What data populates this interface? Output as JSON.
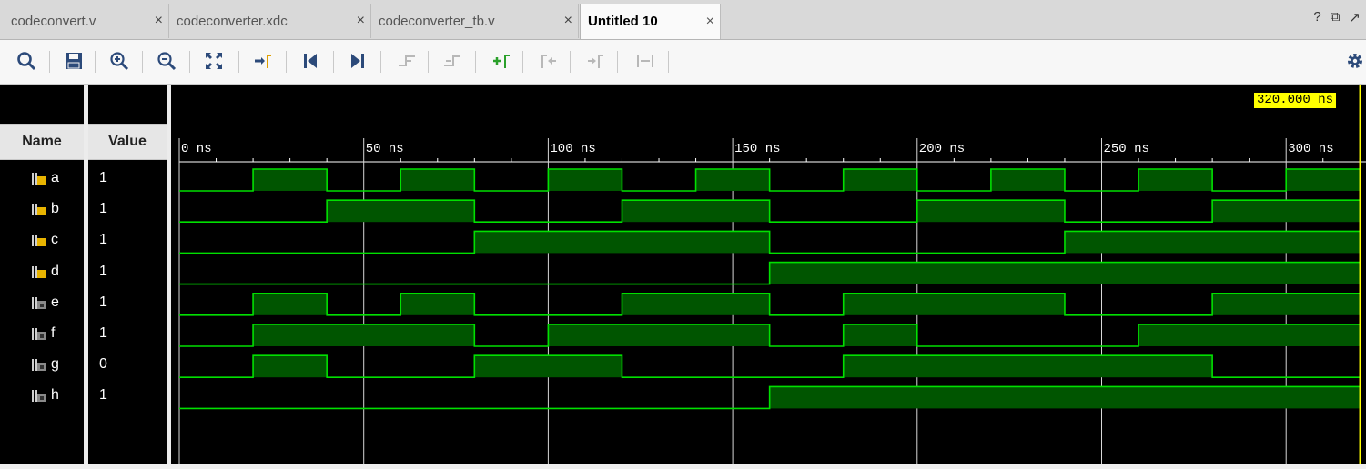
{
  "tabs": [
    {
      "label": "codeconvert.v",
      "active": false
    },
    {
      "label": "codeconverter.xdc",
      "active": false
    },
    {
      "label": "codeconverter_tb.v",
      "active": false
    },
    {
      "label": "Untitled 10",
      "active": true
    }
  ],
  "tab_close_glyph": "×",
  "window_controls": {
    "help": "?",
    "restore": "⧉",
    "float": "↗"
  },
  "toolbar_icons": [
    "search-icon",
    "save-icon",
    "zoom-in-icon",
    "zoom-out-icon",
    "zoom-fit-icon",
    "go-to-cursor-icon",
    "go-to-start-icon",
    "go-to-end-icon",
    "previous-transition-icon",
    "next-transition-icon",
    "add-marker-icon",
    "previous-marker-icon",
    "next-marker-icon",
    "swap-cursors-icon"
  ],
  "settings_icon": "gear-icon",
  "columns": {
    "name": "Name",
    "value": "Value"
  },
  "cursor_time_label": "320.000 ns",
  "timeline": {
    "unit": "ns",
    "start": 0,
    "end": 320,
    "major_ticks": [
      0,
      50,
      100,
      150,
      200,
      250,
      300
    ],
    "tick_labels": [
      "0 ns",
      "50 ns",
      "100 ns",
      "150 ns",
      "200 ns",
      "250 ns",
      "300 ns"
    ]
  },
  "colors": {
    "wave": "#00e000",
    "high_fill": "#005500",
    "cursor": "#ffff00",
    "background": "#000000"
  },
  "signals": [
    {
      "name": "a",
      "value": "1",
      "type": "input",
      "transitions": [
        [
          0,
          0
        ],
        [
          20,
          1
        ],
        [
          40,
          0
        ],
        [
          60,
          1
        ],
        [
          80,
          0
        ],
        [
          100,
          1
        ],
        [
          120,
          0
        ],
        [
          140,
          1
        ],
        [
          160,
          0
        ],
        [
          180,
          1
        ],
        [
          200,
          0
        ],
        [
          220,
          1
        ],
        [
          240,
          0
        ],
        [
          260,
          1
        ],
        [
          280,
          0
        ],
        [
          300,
          1
        ]
      ]
    },
    {
      "name": "b",
      "value": "1",
      "type": "input",
      "transitions": [
        [
          0,
          0
        ],
        [
          40,
          1
        ],
        [
          80,
          0
        ],
        [
          120,
          1
        ],
        [
          160,
          0
        ],
        [
          200,
          1
        ],
        [
          240,
          0
        ],
        [
          280,
          1
        ]
      ]
    },
    {
      "name": "c",
      "value": "1",
      "type": "input",
      "transitions": [
        [
          0,
          0
        ],
        [
          80,
          1
        ],
        [
          160,
          0
        ],
        [
          240,
          1
        ]
      ]
    },
    {
      "name": "d",
      "value": "1",
      "type": "input",
      "transitions": [
        [
          0,
          0
        ],
        [
          160,
          1
        ]
      ]
    },
    {
      "name": "e",
      "value": "1",
      "type": "output",
      "transitions": [
        [
          0,
          0
        ],
        [
          20,
          1
        ],
        [
          40,
          0
        ],
        [
          60,
          1
        ],
        [
          80,
          0
        ],
        [
          120,
          1
        ],
        [
          160,
          0
        ],
        [
          180,
          1
        ],
        [
          240,
          0
        ],
        [
          280,
          1
        ]
      ]
    },
    {
      "name": "f",
      "value": "1",
      "type": "output",
      "transitions": [
        [
          0,
          0
        ],
        [
          20,
          1
        ],
        [
          80,
          0
        ],
        [
          100,
          1
        ],
        [
          160,
          0
        ],
        [
          180,
          1
        ],
        [
          200,
          0
        ],
        [
          260,
          1
        ]
      ]
    },
    {
      "name": "g",
      "value": "0",
      "type": "output",
      "transitions": [
        [
          0,
          0
        ],
        [
          20,
          1
        ],
        [
          40,
          0
        ],
        [
          80,
          1
        ],
        [
          120,
          0
        ],
        [
          180,
          1
        ],
        [
          280,
          0
        ]
      ]
    },
    {
      "name": "h",
      "value": "1",
      "type": "output",
      "transitions": [
        [
          0,
          0
        ],
        [
          160,
          1
        ]
      ]
    }
  ]
}
